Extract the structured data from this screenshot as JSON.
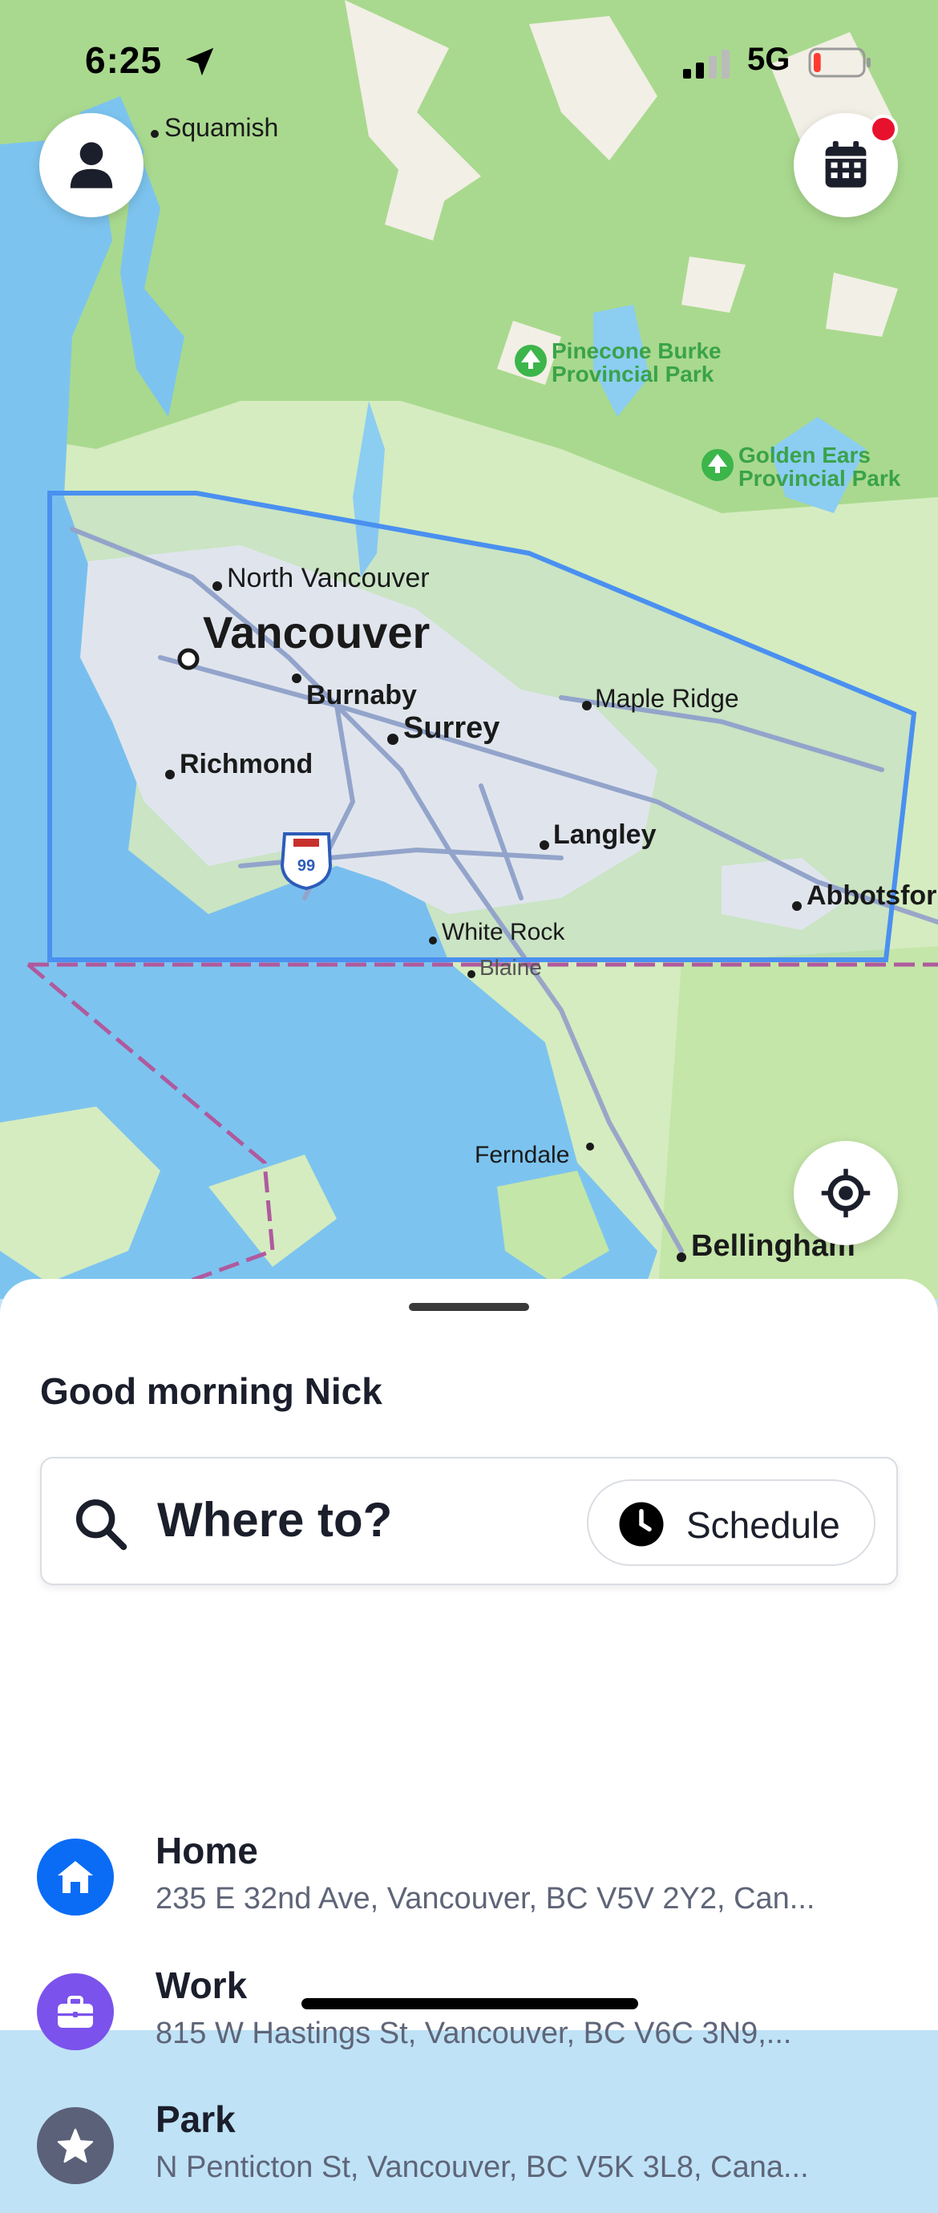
{
  "status_bar": {
    "time": "6:25",
    "network": "5G",
    "battery_level_percent": 15,
    "battery_color": "#ff3b30"
  },
  "map": {
    "labels": {
      "squamish": "Squamish",
      "pinecone": "Pinecone Burke",
      "pinecone2": "Provincial Park",
      "golden": "Golden Ears",
      "golden2": "Provincial Park",
      "north_van": "North Vancouver",
      "vancouver": "Vancouver",
      "burnaby": "Burnaby",
      "maple_ridge": "Maple Ridge",
      "surrey": "Surrey",
      "richmond": "Richmond",
      "langley": "Langley",
      "abbotsford": "Abbotsfor",
      "white_rock": "White Rock",
      "blaine": "Blaine",
      "ferndale": "Ferndale",
      "bellingham": "Bellingham",
      "highway": "99"
    },
    "colors": {
      "land": "#d5ecc0",
      "forest": "#a9d98e",
      "water": "#7cc4ef",
      "urban": "#ededed",
      "zone": "#4a90f0",
      "border": "#b05a9e"
    },
    "icons": {
      "profile": "person-icon",
      "calendar": "calendar-icon",
      "locate": "crosshair-icon",
      "park": "tree-icon"
    }
  },
  "sheet": {
    "greeting": "Good morning Nick",
    "search_placeholder": "Where to?",
    "schedule_label": "Schedule",
    "places": [
      {
        "name": "Home",
        "address": "235 E 32nd Ave, Vancouver, BC V5V 2Y2, Can...",
        "icon": "house-icon",
        "color": "#0a6cf5"
      },
      {
        "name": "Work",
        "address": "815 W Hastings St, Vancouver, BC V6C 3N9,...",
        "icon": "briefcase-icon",
        "color": "#7b52ec"
      },
      {
        "name": "Park",
        "address": "N Penticton St, Vancouver, BC V5K 3L8, Cana...",
        "icon": "star-icon",
        "color": "#5b6178"
      }
    ]
  }
}
